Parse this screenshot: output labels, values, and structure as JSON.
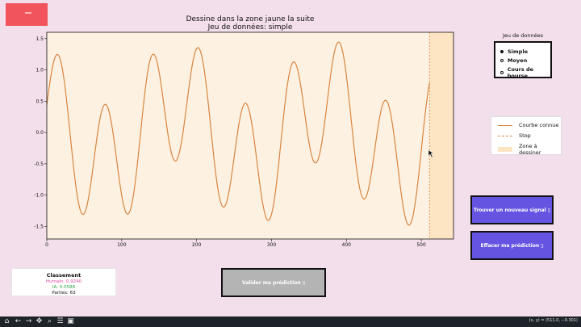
{
  "title": {
    "line1": "Dessine dans la zone jaune la suite",
    "line2": "Jeu de données: simple"
  },
  "chart_data": {
    "type": "line",
    "title": "Dessine dans la zone jaune la suite\nJeu de données: simple",
    "xlim": [
      0,
      543
    ],
    "ylim": [
      -1.7,
      1.6
    ],
    "x_ticks": [
      0,
      100,
      200,
      300,
      400,
      500
    ],
    "y_ticks": [
      1.5,
      1.0,
      0.5,
      0.0,
      -0.5,
      -1.0,
      -1.5
    ],
    "series": [
      {
        "name": "Courbe connue",
        "type": "line",
        "color": "#d8843f",
        "formula": "sin(2*pi*x/62.5) + 0.55*sin(2*pi*x/195 + 2.2)",
        "x_range": [
          0,
          511
        ]
      }
    ],
    "stop_x": 511,
    "draw_zone": {
      "x_from": 511,
      "x_to": 543,
      "color": "#fde4c3"
    },
    "plot_background": "#fdf2e2",
    "legend_position": "right"
  },
  "dataset_selector": {
    "title": "Jeu de données",
    "options": [
      "Simple",
      "Moyen",
      "Cours de bourse"
    ],
    "selected": "Simple"
  },
  "legend": {
    "known_curve": "Courbe connue",
    "stop": "Stop",
    "draw_zone": "Zone à dessiner"
  },
  "buttons": {
    "new_signal": "Trouver un nouveau signal ▯",
    "clear_prediction": "Effacer ma prédiction ▯",
    "validate": "Valider ma prédiction ▯"
  },
  "scoreboard": {
    "title": "Classement",
    "human": "Humain: 0.9240",
    "ia": "IA: 0.0588",
    "games": "Parties: 63"
  },
  "toolbar": {
    "icons": [
      "home-icon",
      "back-icon",
      "forward-icon",
      "pan-icon",
      "zoom-icon",
      "configure-icon",
      "save-icon"
    ],
    "coords": "(x, y) = (511.0, −0.301)"
  }
}
